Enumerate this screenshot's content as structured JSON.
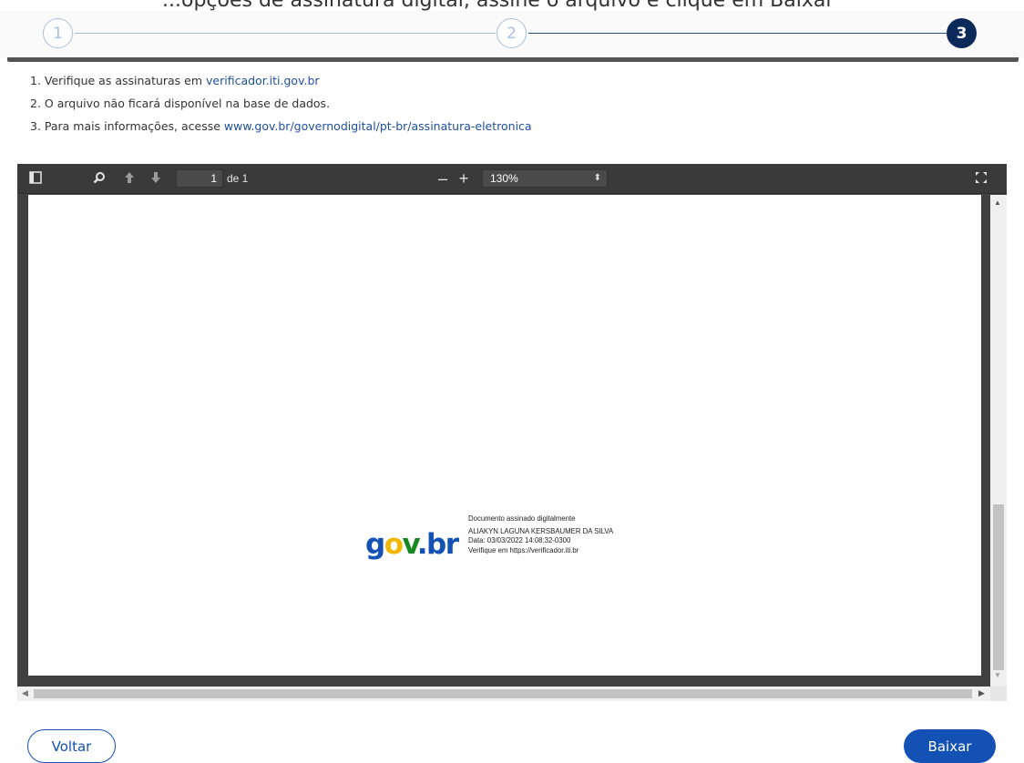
{
  "header": {
    "partial_text": "...opções de assinatura digital, assine o arquivo e clique em Baixar"
  },
  "stepper": {
    "steps": [
      "1",
      "2",
      "3"
    ],
    "active_step": 3
  },
  "info": {
    "item1_prefix": "1. Verifique as assinaturas em ",
    "item1_link": "verificador.iti.gov.br",
    "item2": "2. O arquivo não ficará disponível na base de dados.",
    "item3_prefix": "3. Para mais informações, acesse ",
    "item3_link": "www.gov.br/governodigital/pt-br/assinatura-eletronica"
  },
  "viewer": {
    "page_number": "1",
    "page_of": "de 1",
    "zoom": "130%"
  },
  "stamp": {
    "logo_text": "gov.br",
    "title": "Documento assinado digitalmente",
    "signer": "ALIAKYN LAGUNA KERSBAUMER DA SILVA",
    "date": "Data: 03/03/2022 14:08:32-0300",
    "verify": "Verifique em https://verificador.iti.br"
  },
  "buttons": {
    "back": "Voltar",
    "download": "Baixar"
  },
  "colors": {
    "primary": "#1351b4",
    "step_active": "#0c2a59"
  }
}
